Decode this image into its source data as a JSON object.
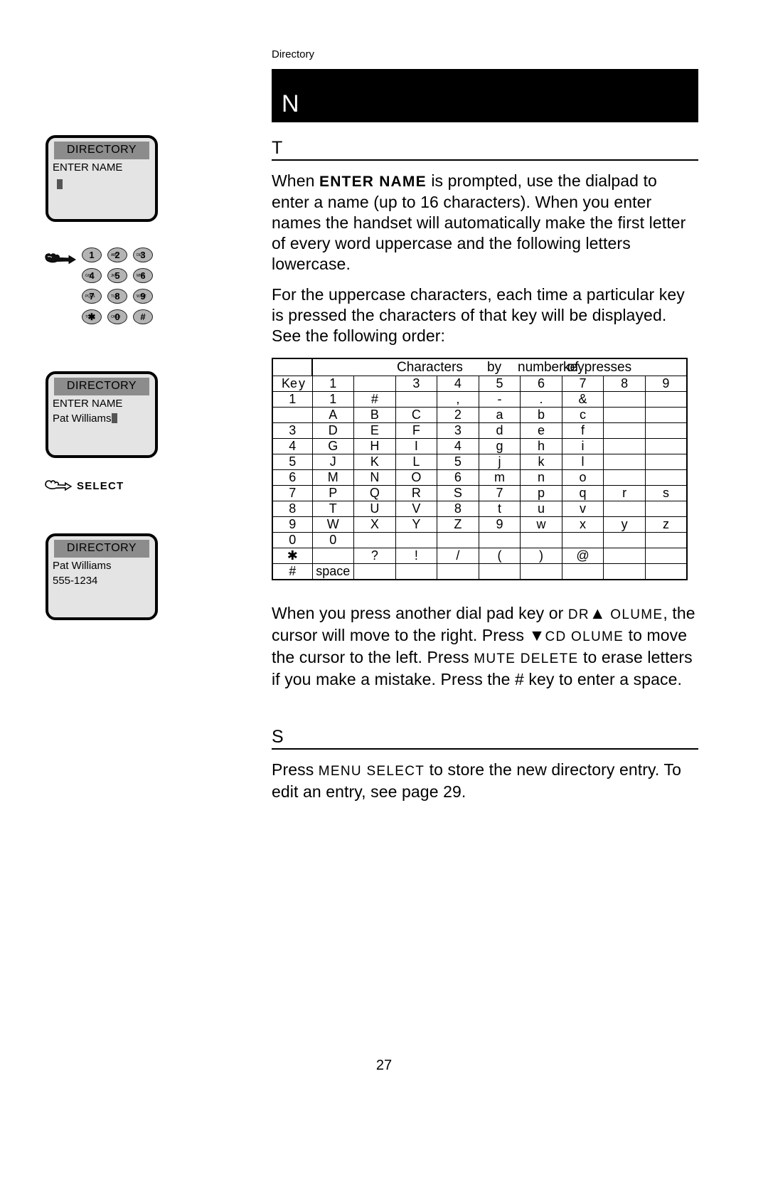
{
  "page": {
    "breadcrumb": "Directory",
    "page_number": "27",
    "banner_title": "N",
    "section_heading_1": "T",
    "section_heading_2": "S"
  },
  "lcd_screens": [
    {
      "title": "DIRECTORY",
      "line1": "ENTER NAME",
      "line2": "",
      "cursor": true
    },
    {
      "title": "DIRECTORY",
      "line1": "ENTER NAME",
      "line2": "Pat Williams",
      "cursor": true
    },
    {
      "title": "DIRECTORY",
      "line1": "Pat Williams",
      "line2": "555-1234",
      "cursor": false
    }
  ],
  "keypad": {
    "keys": [
      {
        "digit": "1",
        "letters": ""
      },
      {
        "digit": "2",
        "letters": "ABC"
      },
      {
        "digit": "3",
        "letters": "DEF"
      },
      {
        "digit": "4",
        "letters": "GHI"
      },
      {
        "digit": "5",
        "letters": "JKL"
      },
      {
        "digit": "6",
        "letters": "MNO"
      },
      {
        "digit": "7",
        "letters": "PQRS"
      },
      {
        "digit": "8",
        "letters": "TUV"
      },
      {
        "digit": "9",
        "letters": "WXYZ"
      },
      {
        "digit": "✱",
        "letters": "TONE"
      },
      {
        "digit": "0",
        "letters": "OPER"
      },
      {
        "digit": "#",
        "letters": ""
      }
    ]
  },
  "cues": {
    "select_label": "SELECT"
  },
  "paragraphs": {
    "p1_a": "When ",
    "p1_lcd": "ENTER NAME",
    "p1_b": " is prompted, use the dialpad to enter a name (up to 16 characters). When you enter names the handset will automatically make the first letter of every word uppercase and the following letters lowercase.",
    "p2": "For the uppercase characters, each time a particular key is pressed the characters of that key will be displayed.  See the following order:",
    "p3_a": "When you press another dial pad key or ",
    "p3_b": "DR",
    "p3_c": "OLUME",
    "p3_d": ",",
    "p3_e": "the cursor will move to the right. Press ",
    "p3_f": "CD",
    "p3_g": "OLUME",
    "p3_h": "to move the cursor to the left. Press ",
    "p3_i": "MUTE",
    "p3_j": "DELETE",
    "p3_k": " to erase letters if you make a mistake. Press the # key to enter a space.",
    "p4_a": "Press ",
    "p4_b": "MENU",
    "p4_c": "SELECT",
    "p4_d": " to store the new directory entry. To edit an entry, see page 29."
  },
  "chars_table": {
    "span_header_parts": [
      "Characters",
      "by",
      "number of",
      "keypresses"
    ],
    "key_column_label": "Key",
    "press_columns": [
      "1",
      "",
      "3",
      "4",
      "5",
      "6",
      "7",
      "8",
      "9"
    ],
    "rows": [
      {
        "key": "1",
        "cells": [
          "1",
          "#",
          "",
          ",",
          "-",
          ".",
          "&",
          "",
          ""
        ]
      },
      {
        "key": "",
        "cells": [
          "A",
          "B",
          "C",
          "2",
          "a",
          "b",
          "c",
          "",
          ""
        ]
      },
      {
        "key": "3",
        "cells": [
          "D",
          "E",
          "F",
          "3",
          "d",
          "e",
          "f",
          "",
          ""
        ]
      },
      {
        "key": "4",
        "cells": [
          "G",
          "H",
          "I",
          "4",
          "g",
          "h",
          "i",
          "",
          ""
        ]
      },
      {
        "key": "5",
        "cells": [
          "J",
          "K",
          "L",
          "5",
          "j",
          "k",
          "l",
          "",
          ""
        ]
      },
      {
        "key": "6",
        "cells": [
          "M",
          "N",
          "O",
          "6",
          "m",
          "n",
          "o",
          "",
          ""
        ]
      },
      {
        "key": "7",
        "cells": [
          "P",
          "Q",
          "R",
          "S",
          "7",
          "p",
          "q",
          "r",
          "s"
        ]
      },
      {
        "key": "8",
        "cells": [
          "T",
          "U",
          "V",
          "8",
          "t",
          "u",
          "v",
          "",
          ""
        ]
      },
      {
        "key": "9",
        "cells": [
          "W",
          "X",
          "Y",
          "Z",
          "9",
          "w",
          "x",
          "y",
          "z"
        ]
      },
      {
        "key": "0",
        "cells": [
          "0",
          "",
          "",
          "",
          "",
          "",
          "",
          "",
          ""
        ]
      },
      {
        "key": "✱",
        "cells": [
          "",
          "?",
          "!",
          "/",
          "(",
          ")",
          "@",
          "",
          ""
        ]
      },
      {
        "key": "#",
        "cells": [
          "space",
          "",
          "",
          "",
          "",
          "",
          "",
          "",
          ""
        ]
      }
    ]
  }
}
